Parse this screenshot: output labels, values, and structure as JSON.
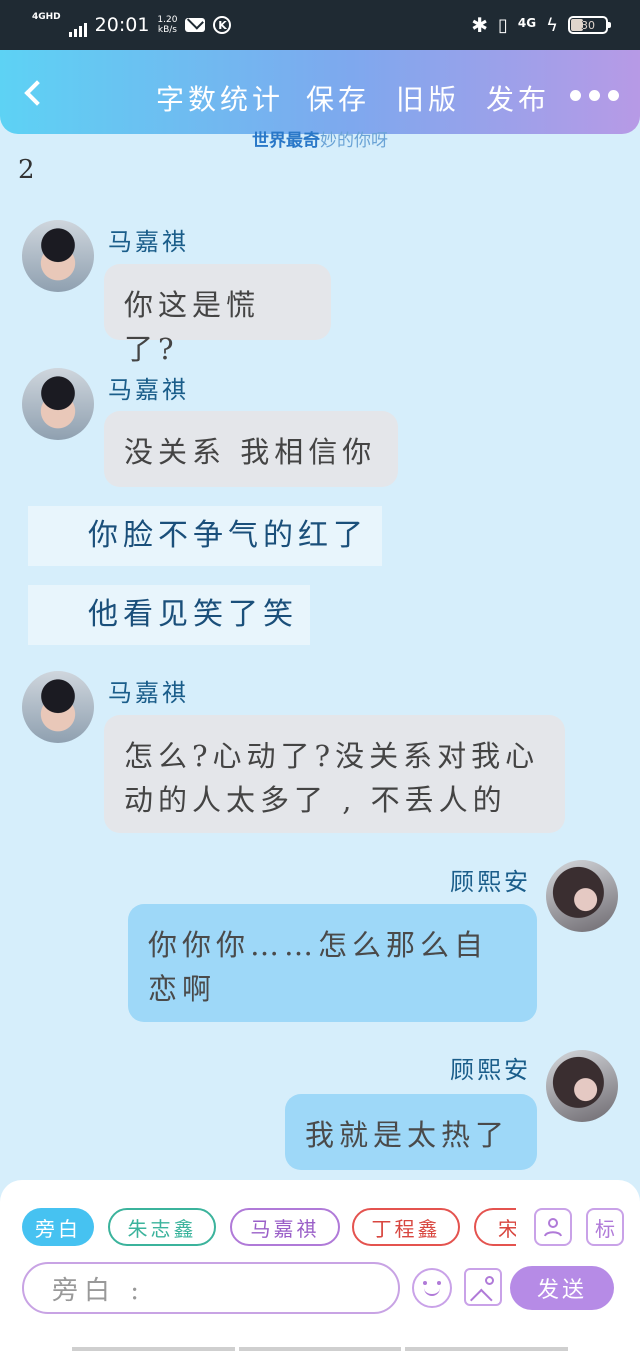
{
  "status_bar": {
    "network": "4GHD",
    "time": "20:01",
    "speed_value": "1.20",
    "speed_unit": "kB/s",
    "network_right": "4G",
    "battery": "30"
  },
  "header": {
    "buttons": [
      "字数统计",
      "保存",
      "旧版",
      "发布"
    ],
    "subtitle_a": "世界最奇",
    "subtitle_b": "妙的你呀"
  },
  "page_number": "2",
  "messages": [
    {
      "sender": "马嘉祺",
      "text": "你这是慌了?"
    },
    {
      "sender": "马嘉祺",
      "text": "没关系 我相信你"
    },
    {
      "narration": "你脸不争气的红了"
    },
    {
      "narration": "他看见笑了笑"
    },
    {
      "sender": "马嘉祺",
      "text": "怎么?心动了?没关系对我心动的人太多了 , 不丢人的"
    },
    {
      "sender": "顾熙安",
      "text": "你你你……怎么那么自恋啊"
    },
    {
      "sender": "顾熙安",
      "text": "我就是太热了"
    }
  ],
  "composer": {
    "chips": [
      "旁白",
      "朱志鑫",
      "马嘉祺",
      "丁程鑫",
      "宋"
    ],
    "tag_label": "标",
    "input_placeholder": "旁白 :",
    "send_label": "发送"
  },
  "colors": {
    "background": "#d6eefb",
    "header_start": "#5dd2f4",
    "header_end": "#b79ae6",
    "accent_purple": "#b68be6",
    "chip_active": "#46c2f1"
  }
}
